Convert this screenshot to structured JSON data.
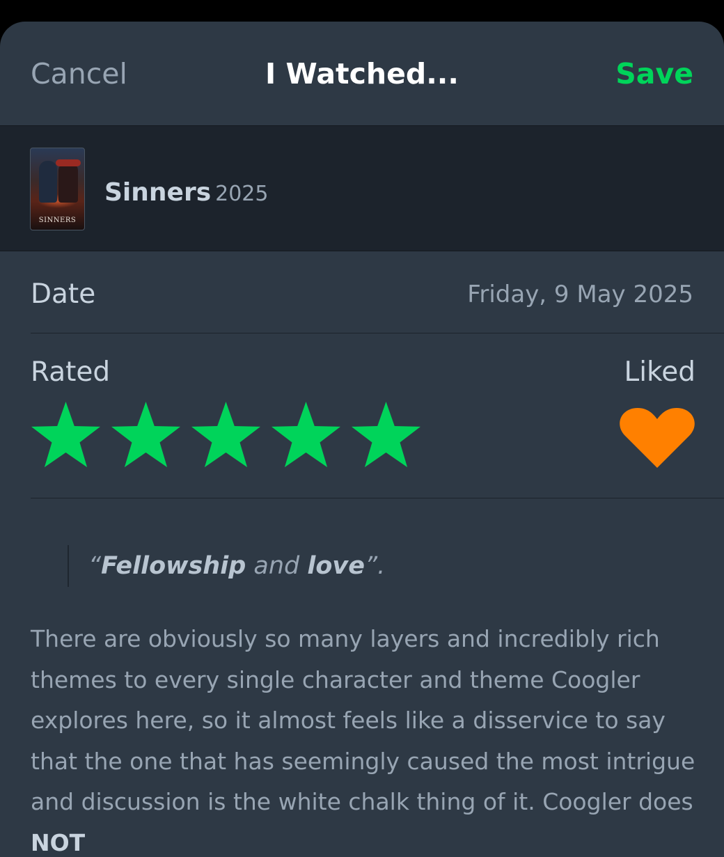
{
  "header": {
    "cancel_label": "Cancel",
    "title": "I Watched...",
    "save_label": "Save"
  },
  "film": {
    "title": "Sinners",
    "year": "2025",
    "poster_text": "SINNERS"
  },
  "date": {
    "label": "Date",
    "value": "Friday, 9 May 2025"
  },
  "rating": {
    "label": "Rated",
    "stars": 5,
    "max_stars": 5,
    "star_color": "#00d45a"
  },
  "liked": {
    "label": "Liked",
    "value": true,
    "heart_color": "#ff8000"
  },
  "review": {
    "quote_open": "“",
    "quote_word1": "Fellowship",
    "quote_mid": " and ",
    "quote_word2": "love",
    "quote_close": "”.",
    "body": "There are obviously so many layers and incredibly rich themes to every single character and theme Coogler explores here, so it almost feels like a disservice to say that the one that has seemingly caused the most intrigue and discussion is the white chalk thing of it. Coogler does ",
    "body_bold": "NOT"
  },
  "colors": {
    "background": "#2e3945",
    "film_row_bg": "#1c232c",
    "accent_green": "#00d45a",
    "accent_orange": "#ff8000"
  }
}
